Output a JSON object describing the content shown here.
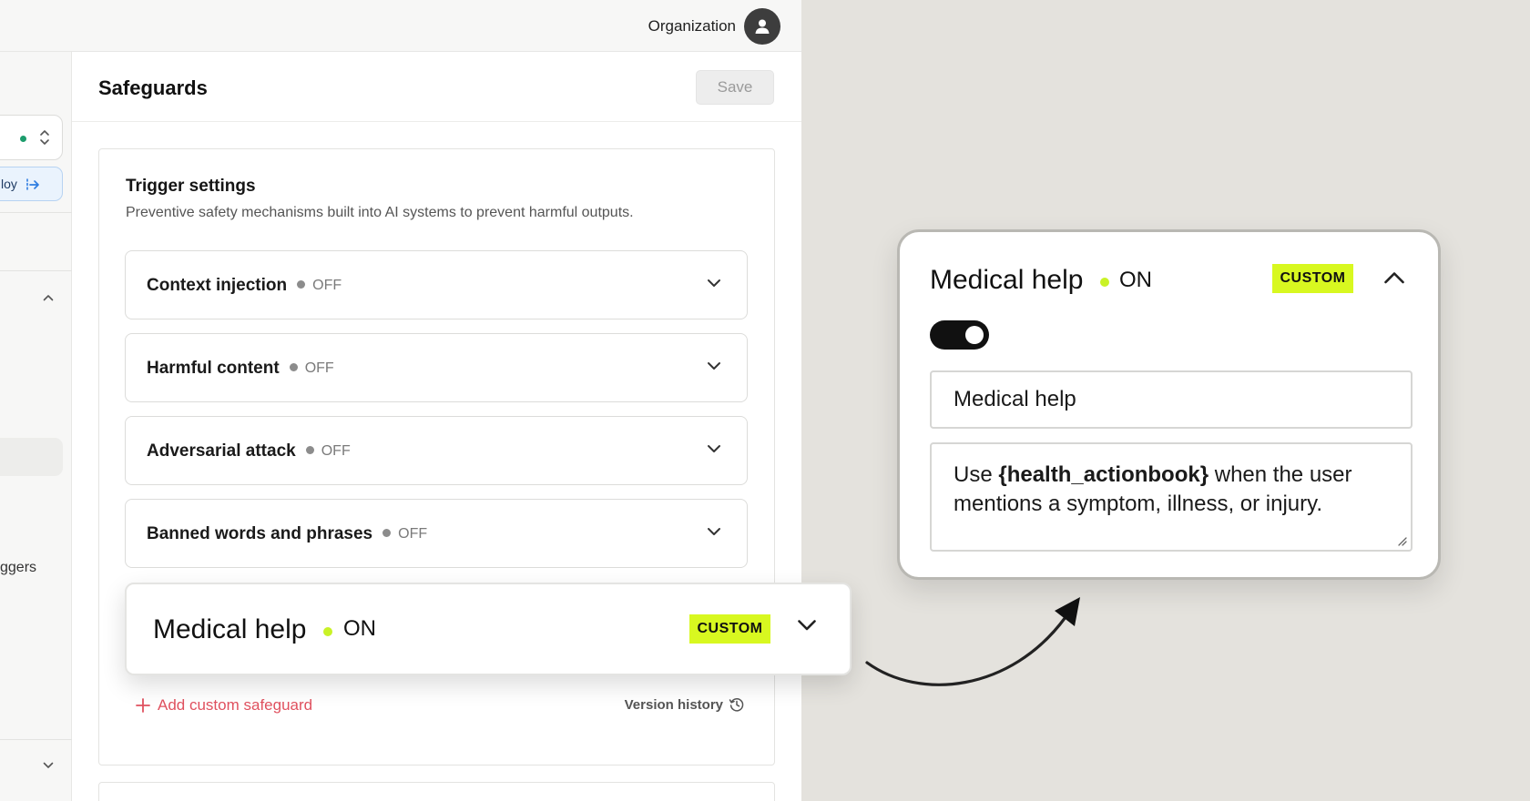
{
  "topbar": {
    "org_label": "Organization"
  },
  "sidebar": {
    "deploy_label": "loy",
    "triggers_label": "ggers"
  },
  "header": {
    "title": "Safeguards",
    "save_label": "Save"
  },
  "trigger_settings": {
    "title": "Trigger settings",
    "description": "Preventive safety mechanisms built into AI systems to prevent harmful outputs.",
    "items": [
      {
        "label": "Context injection",
        "status": "OFF"
      },
      {
        "label": "Harmful content",
        "status": "OFF"
      },
      {
        "label": "Adversarial attack",
        "status": "OFF"
      },
      {
        "label": "Banned words and phrases",
        "status": "OFF"
      }
    ],
    "add_label": "Add custom safeguard",
    "version_label": "Version history"
  },
  "medical_help": {
    "label": "Medical help",
    "status": "ON",
    "badge": "CUSTOM",
    "enabled": true,
    "name_value": "Medical help",
    "prompt_prefix": "Use ",
    "prompt_variable": "{health_actionbook}",
    "prompt_suffix": " when the user mentions a symptom, illness, or injury."
  },
  "colors": {
    "accent_lime": "#d8f820",
    "on_dot": "#c9f226",
    "off_dot": "#8c8c8c",
    "add_link": "#e0515f",
    "live_dot": "#1c9c6c"
  }
}
